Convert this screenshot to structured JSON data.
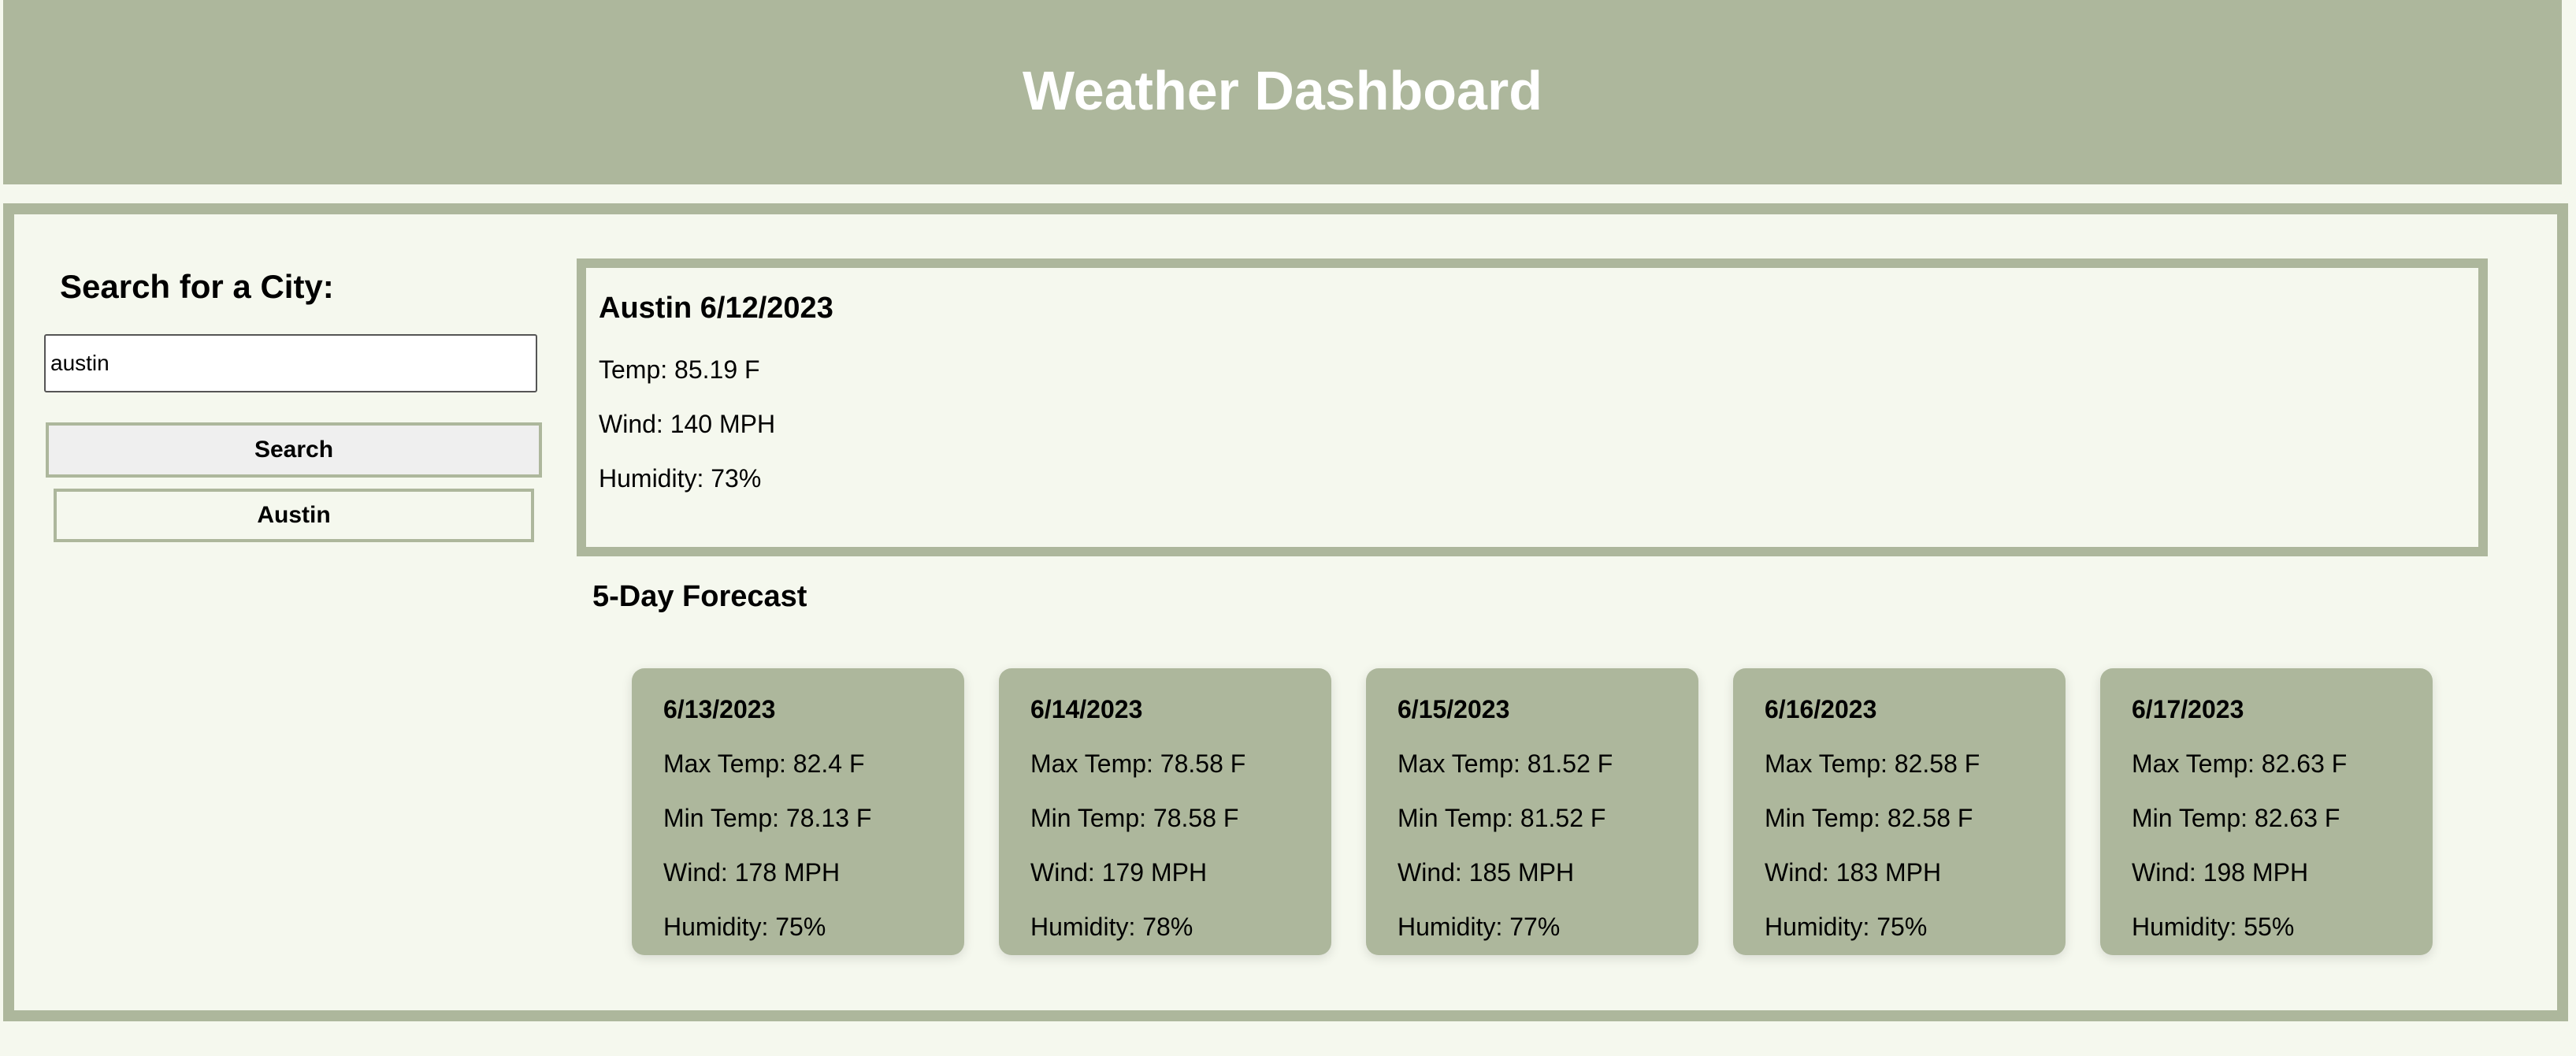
{
  "header": {
    "title": "Weather Dashboard"
  },
  "sidebar": {
    "title": "Search for a City:",
    "search_value": "austin",
    "search_button": "Search",
    "history": [
      "Austin"
    ]
  },
  "current": {
    "heading": "Austin 6/12/2023",
    "temp": "Temp: 85.19 F",
    "wind": "Wind: 140 MPH",
    "humidity": "Humidity: 73%"
  },
  "forecast": {
    "title": "5-Day Forecast",
    "days": [
      {
        "date": "6/13/2023",
        "max": "Max Temp: 82.4 F",
        "min": "Min Temp: 78.13 F",
        "wind": "Wind: 178 MPH",
        "humidity": "Humidity: 75%"
      },
      {
        "date": "6/14/2023",
        "max": "Max Temp: 78.58 F",
        "min": "Min Temp: 78.58 F",
        "wind": "Wind: 179 MPH",
        "humidity": "Humidity: 78%"
      },
      {
        "date": "6/15/2023",
        "max": "Max Temp: 81.52 F",
        "min": "Min Temp: 81.52 F",
        "wind": "Wind: 185 MPH",
        "humidity": "Humidity: 77%"
      },
      {
        "date": "6/16/2023",
        "max": "Max Temp: 82.58 F",
        "min": "Min Temp: 82.58 F",
        "wind": "Wind: 183 MPH",
        "humidity": "Humidity: 75%"
      },
      {
        "date": "6/17/2023",
        "max": "Max Temp: 82.63 F",
        "min": "Min Temp: 82.63 F",
        "wind": "Wind: 198 MPH",
        "humidity": "Humidity: 55%"
      }
    ]
  },
  "colors": {
    "accent": "#adb79c",
    "background": "#f5f8ee",
    "header_text": "#ffffff"
  }
}
